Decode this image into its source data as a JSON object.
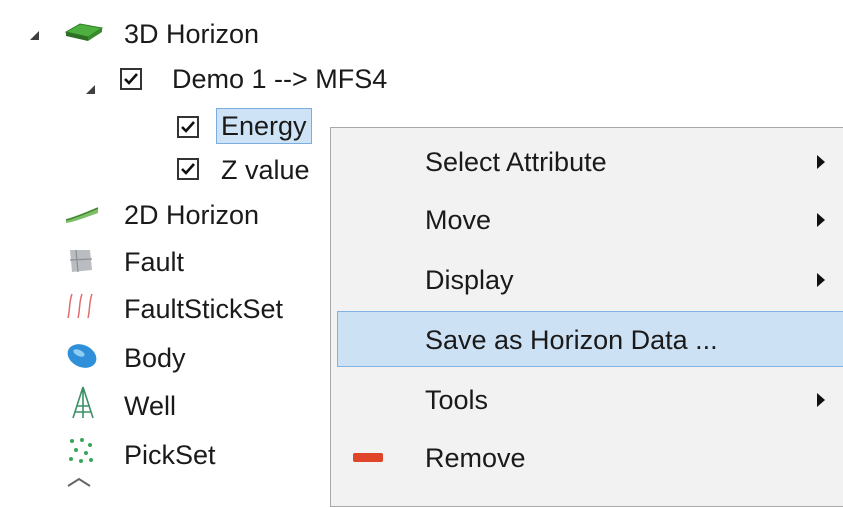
{
  "tree": {
    "root": {
      "label": "3D Horizon",
      "icon": "horizon-3d-icon"
    },
    "child": {
      "label": "Demo 1 --> MFS4",
      "checked": true
    },
    "attributes": [
      {
        "label": "Energy",
        "checked": true,
        "selected": true
      },
      {
        "label": "Z value",
        "checked": true
      }
    ],
    "siblings": [
      {
        "label": "2D Horizon",
        "icon": "horizon-2d-icon"
      },
      {
        "label": "Fault",
        "icon": "fault-icon"
      },
      {
        "label": "FaultStickSet",
        "icon": "faultstickset-icon"
      },
      {
        "label": "Body",
        "icon": "body-icon"
      },
      {
        "label": "Well",
        "icon": "well-icon"
      },
      {
        "label": "PickSet",
        "icon": "pickset-icon"
      }
    ]
  },
  "context_menu": {
    "items": [
      {
        "label": "Select Attribute",
        "submenu": true
      },
      {
        "label": "Move",
        "submenu": true
      },
      {
        "label": "Display",
        "submenu": true
      },
      {
        "label": "Save as Horizon Data ...",
        "submenu": false,
        "highlighted": true
      },
      {
        "label": "Tools",
        "submenu": true
      },
      {
        "label": "Remove",
        "submenu": false,
        "icon": "remove-icon"
      }
    ]
  },
  "colors": {
    "selection_fill": "#cfe3f6",
    "menu_background": "#f2f2f2",
    "menu_highlight": "#cde1f5",
    "remove_icon": "#e0452a"
  }
}
